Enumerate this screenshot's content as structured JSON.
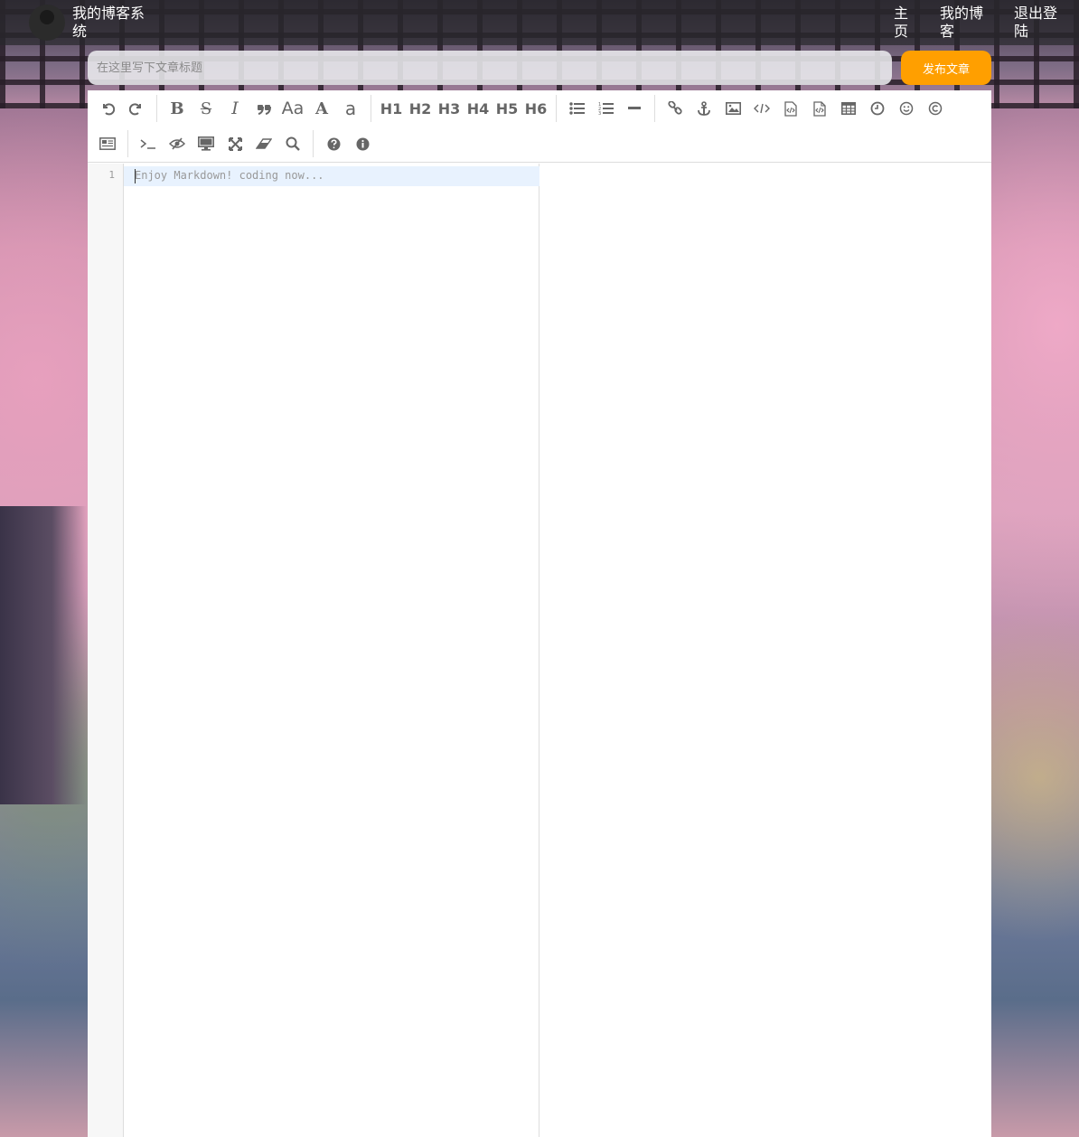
{
  "navbar": {
    "brand": "我的博客系统",
    "links": {
      "home": "主页",
      "my_blog": "我的博客",
      "logout": "退出登陆"
    }
  },
  "title_row": {
    "placeholder": "在这里写下文章标题",
    "value": "",
    "publish_label": "发布文章",
    "publish_color": "#ff9f00"
  },
  "toolbar": {
    "headings": [
      "H1",
      "H2",
      "H3",
      "H4",
      "H5",
      "H6"
    ],
    "case_labels": {
      "upper": "Aa",
      "ucwords": "A",
      "lower": "a"
    },
    "icons_row1": [
      "undo-icon",
      "redo-icon",
      "bold-icon",
      "strikethrough-icon",
      "italic-icon",
      "quote-icon",
      "link-icon",
      "anchor-icon",
      "image-icon",
      "code-icon",
      "preformatted-code-icon",
      "code-block-icon",
      "table-icon",
      "datetime-icon",
      "emoji-icon",
      "html-entities-icon"
    ],
    "icons_row2": [
      "page-break-icon",
      "goto-line-icon",
      "unwatch-icon",
      "preview-icon",
      "fullscreen-icon",
      "clear-icon",
      "search-icon",
      "help-icon",
      "info-icon"
    ]
  },
  "editor": {
    "line_number": "1",
    "placeholder": "Enjoy Markdown! coding now...",
    "accent_line_color": "#e8f2fe"
  }
}
